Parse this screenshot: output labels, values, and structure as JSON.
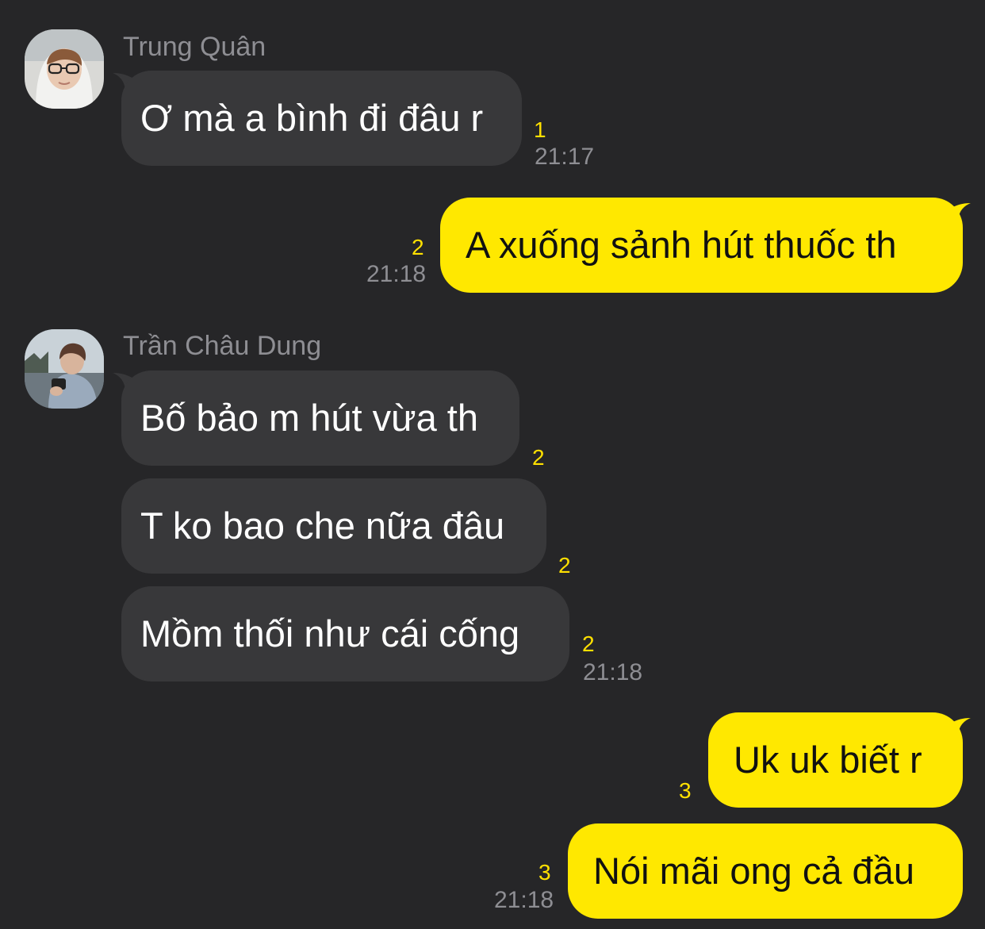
{
  "messages": [
    {
      "sender": "Trung Quân",
      "text": "Ơ mà a bình đi đâu r",
      "unread": "1",
      "time": "21:17"
    },
    {
      "text": "A xuống sảnh hút thuốc th",
      "unread": "2",
      "time": "21:18"
    },
    {
      "sender": "Trần Châu Dung",
      "text": "Bố bảo m hút vừa th",
      "unread": "2"
    },
    {
      "text": "T ko bao che nữa đâu",
      "unread": "2"
    },
    {
      "text": "Mồm thối như cái cống",
      "unread": "2",
      "time": "21:18"
    },
    {
      "text": "Uk uk biết r",
      "unread": "3"
    },
    {
      "text": "Nói mãi ong cả đầu",
      "unread": "3",
      "time": "21:18"
    }
  ],
  "colors": {
    "background": "#262628",
    "incoming_bubble": "#38383a",
    "outgoing_bubble": "#ffe800",
    "unread_count": "#ffe000",
    "meta_text": "#8e8e93"
  },
  "icons": [
    "avatar-trung-quan",
    "avatar-tran-chau-dung",
    "bubble-tail"
  ]
}
